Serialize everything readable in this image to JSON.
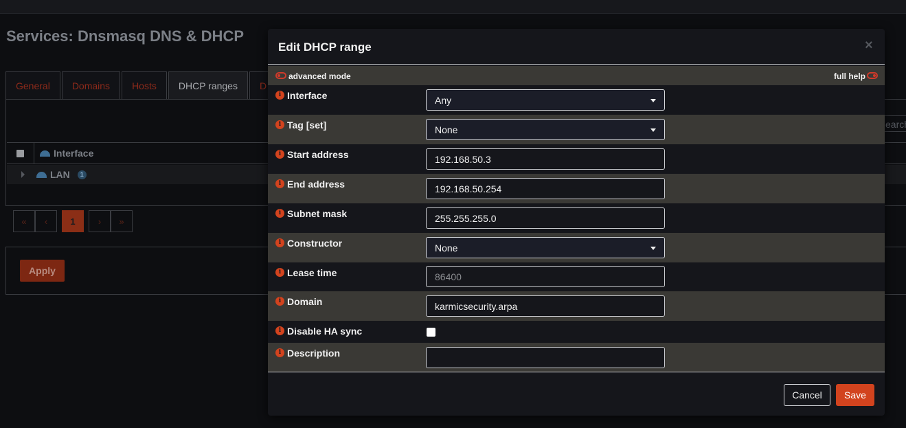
{
  "page": {
    "title": "Services: Dnsmasq DNS & DHCP",
    "tabs": [
      {
        "label": "General"
      },
      {
        "label": "Domains"
      },
      {
        "label": "Hosts"
      },
      {
        "label": "DHCP ranges"
      },
      {
        "label": "D"
      }
    ],
    "search_placeholder_fragment": "earch",
    "grid": {
      "column_interface": "Interface",
      "row_label": "LAN",
      "row_count": "1"
    },
    "pager": {
      "first": "«",
      "prev": "‹",
      "current": "1",
      "next": "›",
      "last": "»"
    },
    "apply_label": "Apply"
  },
  "modal": {
    "title": "Edit DHCP range",
    "close": "×",
    "advanced_mode_label": "advanced mode",
    "full_help_label": "full help",
    "info_glyph": "i",
    "fields": {
      "interface": {
        "label": "Interface",
        "value": "Any"
      },
      "tag": {
        "label": "Tag [set]",
        "value": "None"
      },
      "start_address": {
        "label": "Start address",
        "value": "192.168.50.3"
      },
      "end_address": {
        "label": "End address",
        "value": "192.168.50.254"
      },
      "subnet_mask": {
        "label": "Subnet mask",
        "value": "255.255.255.0"
      },
      "constructor": {
        "label": "Constructor",
        "value": "None"
      },
      "lease_time": {
        "label": "Lease time",
        "placeholder": "86400"
      },
      "domain": {
        "label": "Domain",
        "value": "karmicsecurity.arpa"
      },
      "disable_ha_sync": {
        "label": "Disable HA sync",
        "checked": false
      },
      "description": {
        "label": "Description",
        "value": ""
      }
    },
    "cancel_label": "Cancel",
    "save_label": "Save"
  },
  "colors": {
    "accent": "#d2431e",
    "background": "#0d0e11",
    "modal_bg": "#15161b",
    "alt_row": "#3a3935"
  }
}
